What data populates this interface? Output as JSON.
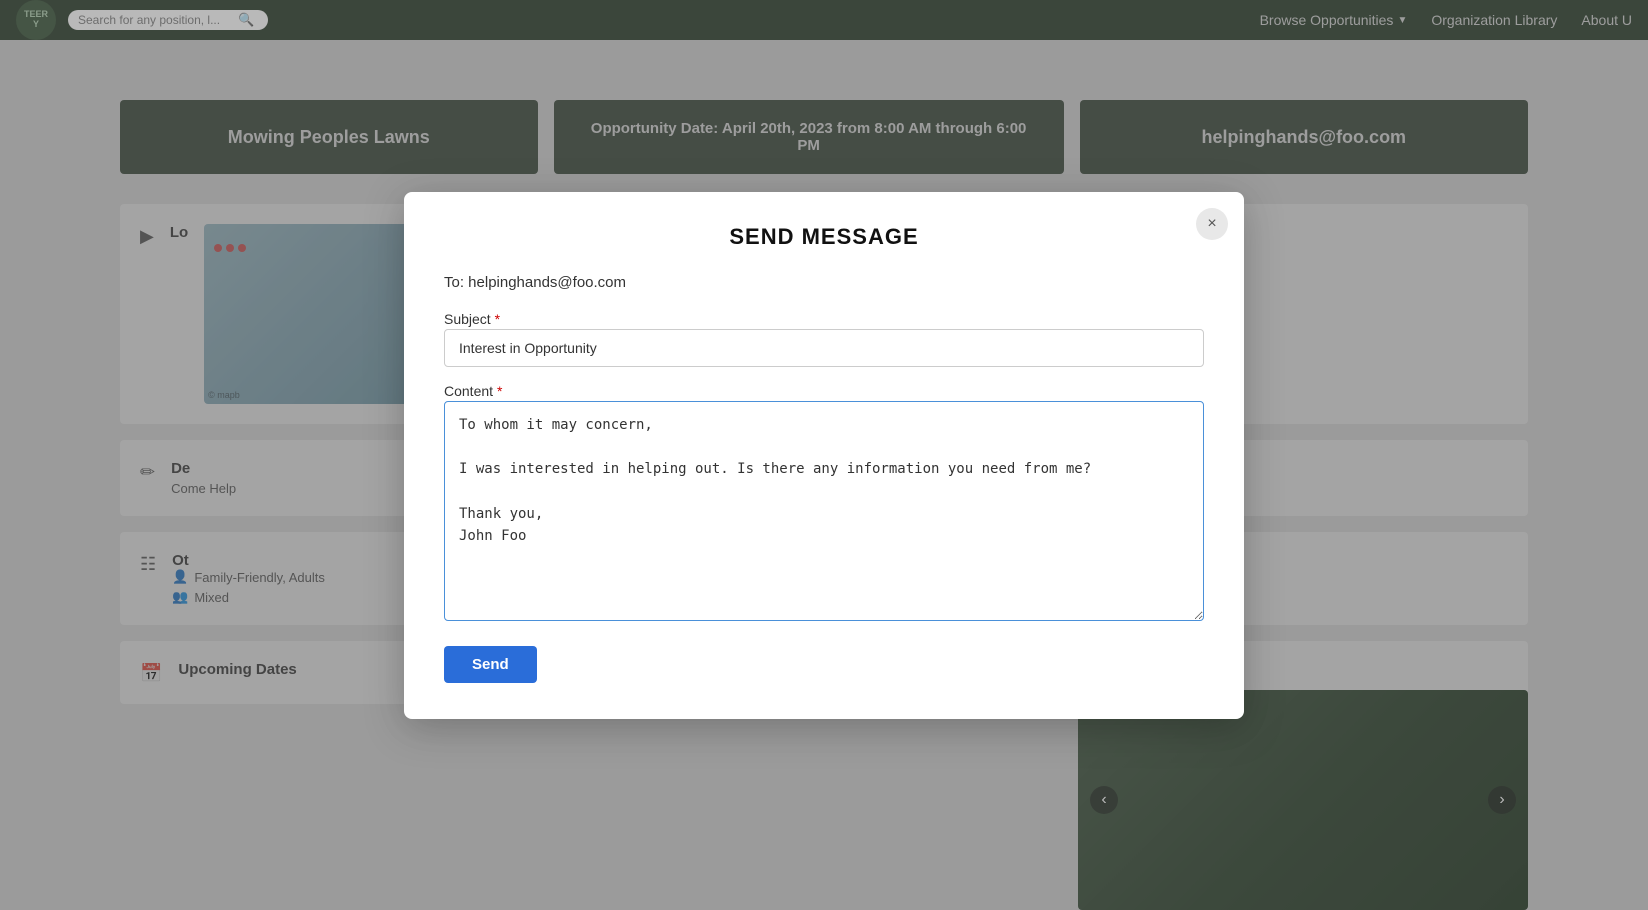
{
  "navbar": {
    "logo_text": "TEER\nY",
    "search_placeholder": "Search for any position, l...",
    "links": [
      {
        "id": "browse",
        "label": "Browse Opportunities",
        "has_dropdown": true
      },
      {
        "id": "org-library",
        "label": "Organization Library",
        "has_dropdown": false
      },
      {
        "id": "about",
        "label": "About U",
        "has_dropdown": false
      }
    ]
  },
  "opportunity": {
    "title": "Mowing Peoples Lawns",
    "date_banner": "Opportunity Date: April 20th, 2023 from 8:00 AM through 6:00 PM",
    "email_banner": "helpinghands@foo.com"
  },
  "content": {
    "location_label": "Lo",
    "description_label": "De",
    "description_text": "Come Help",
    "other_label": "Ot",
    "tags": [
      "Family-Friendly, Adults",
      "Mixed"
    ],
    "upcoming_label": "Upcoming Dates"
  },
  "modal": {
    "title": "SEND MESSAGE",
    "to_label": "To: helpinghands@foo.com",
    "subject_label": "Subject",
    "subject_required": true,
    "subject_value": "Interest in Opportunity",
    "content_label": "Content",
    "content_required": true,
    "content_value": "To whom it may concern,\n\nI was interested in helping out. Is there any information you need from me?\n\nThank you,\nJohn Foo",
    "send_label": "Send",
    "close_label": "×"
  }
}
